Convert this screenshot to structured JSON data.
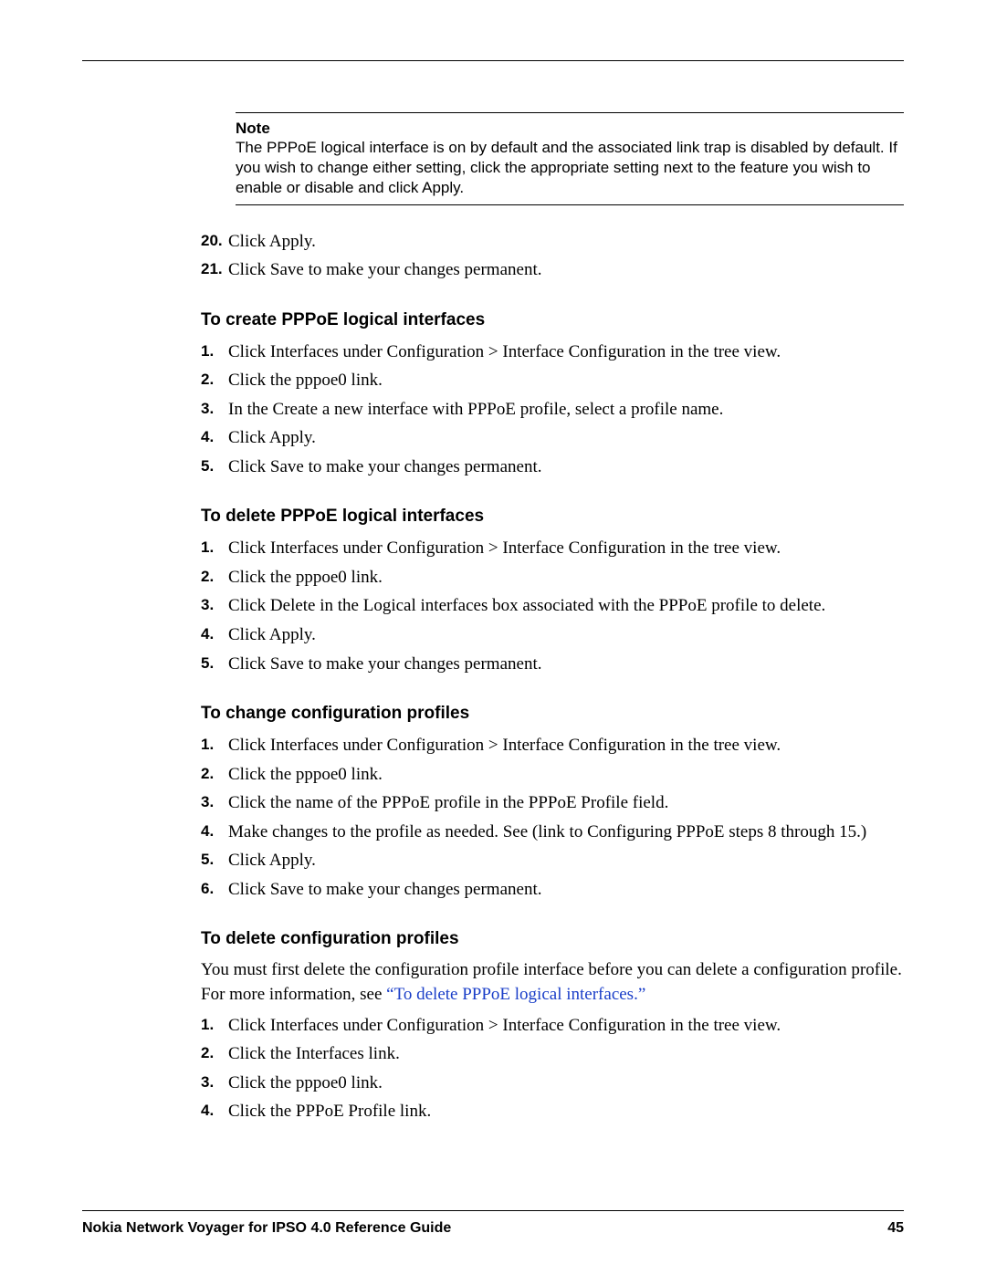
{
  "note": {
    "label": "Note",
    "body": "The PPPoE logical interface is on by default and the associated link trap is disabled by default. If you wish to change either setting, click the appropriate setting next to the feature you wish to enable or disable and click Apply."
  },
  "cont_items": [
    {
      "num": "20.",
      "text": "Click Apply."
    },
    {
      "num": "21.",
      "text": "Click Save to make your changes permanent."
    }
  ],
  "sections": {
    "create": {
      "heading": "To create PPPoE logical interfaces",
      "items": [
        {
          "num": "1.",
          "text": "Click Interfaces under Configuration > Interface Configuration in the tree view."
        },
        {
          "num": "2.",
          "text": "Click the pppoe0 link."
        },
        {
          "num": "3.",
          "text": "In the Create a new interface with PPPoE profile, select a profile name."
        },
        {
          "num": "4.",
          "text": "Click Apply."
        },
        {
          "num": "5.",
          "text": "Click Save to make your changes permanent."
        }
      ]
    },
    "delete_ifaces": {
      "heading": "To delete PPPoE logical interfaces",
      "items": [
        {
          "num": "1.",
          "text": "Click Interfaces under Configuration > Interface Configuration in the tree view."
        },
        {
          "num": "2.",
          "text": "Click the pppoe0 link."
        },
        {
          "num": "3.",
          "text": "Click Delete in the Logical interfaces box associated with the PPPoE profile to delete."
        },
        {
          "num": "4.",
          "text": "Click Apply."
        },
        {
          "num": "5.",
          "text": "Click Save to make your changes permanent."
        }
      ]
    },
    "change_profiles": {
      "heading": "To change configuration profiles",
      "items": [
        {
          "num": "1.",
          "text": "Click Interfaces under Configuration > Interface Configuration in the tree view."
        },
        {
          "num": "2.",
          "text": "Click the pppoe0 link."
        },
        {
          "num": "3.",
          "text": "Click the name of the PPPoE profile in the PPPoE Profile field."
        },
        {
          "num": "4.",
          "text": "Make changes to the profile as needed. See (link to Configuring PPPoE steps 8 through 15.)"
        },
        {
          "num": "5.",
          "text": "Click Apply."
        },
        {
          "num": "6.",
          "text": "Click Save to make your changes permanent."
        }
      ]
    },
    "delete_profiles": {
      "heading": "To delete configuration profiles",
      "intro_pre": "You must first delete the configuration profile interface before you can delete a configuration profile. For more information, see ",
      "intro_link": "“To delete PPPoE logical interfaces.”",
      "items": [
        {
          "num": "1.",
          "text": "Click Interfaces under Configuration > Interface Configuration in the tree view."
        },
        {
          "num": "2.",
          "text": "Click the Interfaces link."
        },
        {
          "num": "3.",
          "text": "Click the pppoe0 link."
        },
        {
          "num": "4.",
          "text": "Click the PPPoE Profile link."
        }
      ]
    }
  },
  "footer": {
    "title": "Nokia Network Voyager for IPSO 4.0 Reference Guide",
    "page": "45"
  }
}
